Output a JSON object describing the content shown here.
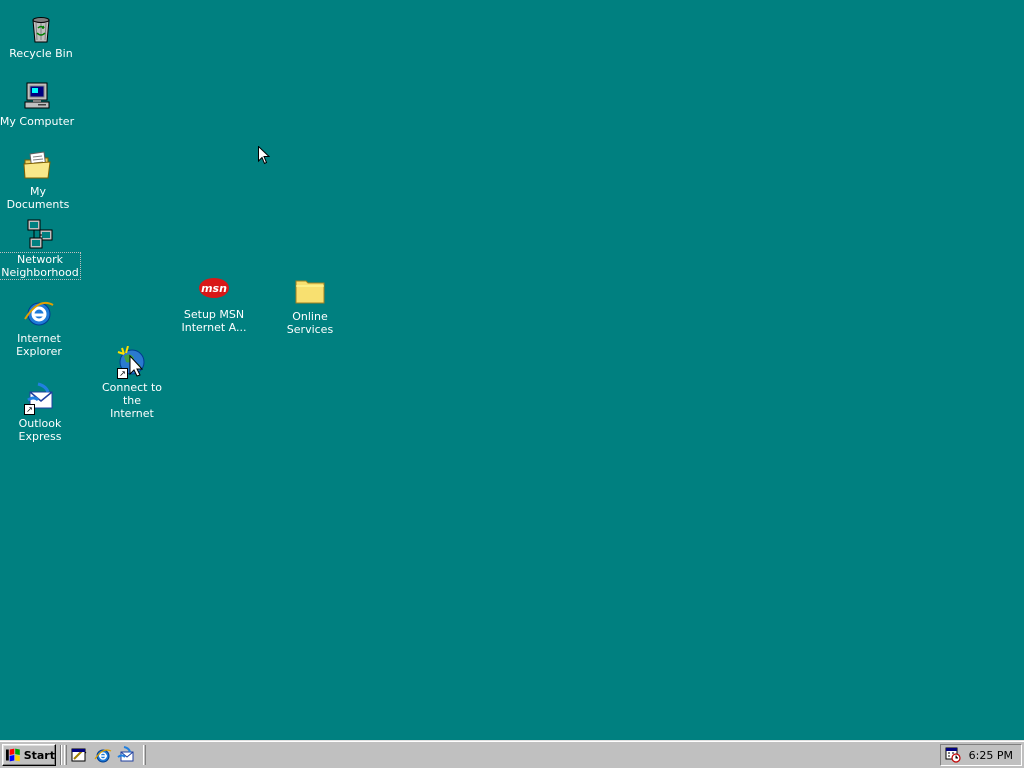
{
  "desktop": {
    "background_color": "#008080",
    "icons": [
      {
        "label": "Recycle Bin",
        "icon": "recycle-bin-icon"
      },
      {
        "label": "My Computer",
        "icon": "my-computer-icon"
      },
      {
        "label": "My Documents",
        "icon": "my-documents-icon"
      },
      {
        "label_line1": "Network",
        "label_line2": "Neighborhood",
        "icon": "network-neighborhood-icon",
        "focused": true
      },
      {
        "label_line1": "Internet",
        "label_line2": "Explorer",
        "icon": "internet-explorer-icon"
      },
      {
        "label_line1": "Outlook",
        "label_line2": "Express",
        "icon": "outlook-express-icon",
        "shortcut": true
      },
      {
        "label_line1": "Connect to the",
        "label_line2": "Internet",
        "icon": "connect-internet-icon",
        "shortcut": true
      },
      {
        "label_line1": "Setup MSN",
        "label_line2": "Internet A...",
        "icon": "msn-icon"
      },
      {
        "label_line1": "Online",
        "label_line2": "Services",
        "icon": "folder-icon"
      }
    ]
  },
  "taskbar": {
    "start_label": "Start",
    "quick_launch": [
      {
        "icon": "show-desktop-icon"
      },
      {
        "icon": "internet-explorer-icon"
      },
      {
        "icon": "outlook-express-icon"
      }
    ],
    "tray": {
      "icon": "task-scheduler-icon",
      "clock": "6:25 PM"
    }
  }
}
